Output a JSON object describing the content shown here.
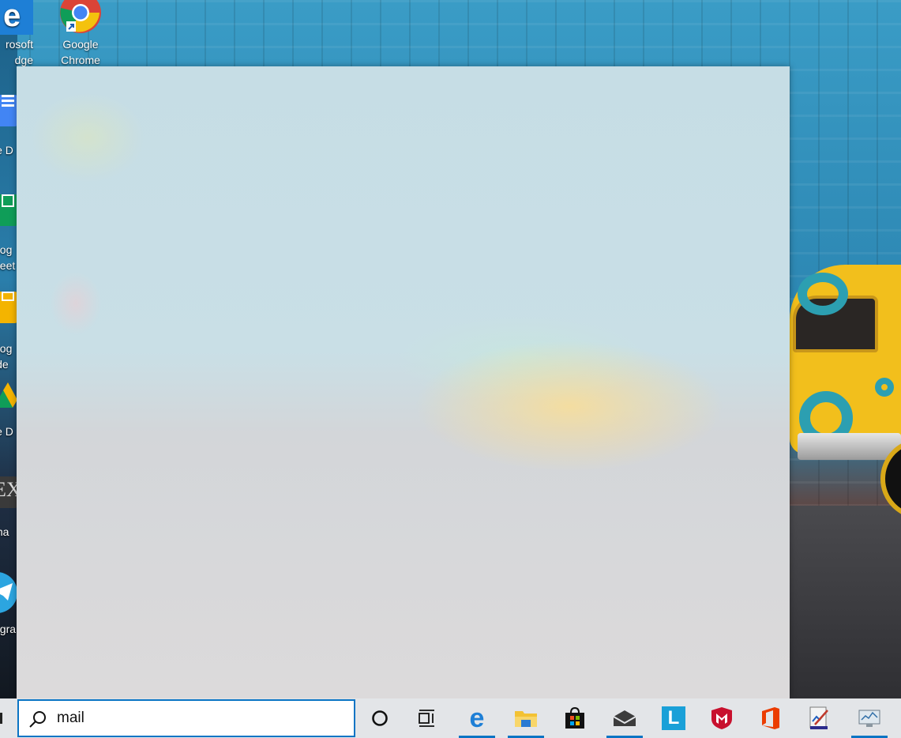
{
  "desktop": {
    "icons": [
      {
        "label": "rosoft\ndge",
        "icon": "microsoft-edge-icon"
      },
      {
        "label": "Google\nChrome",
        "icon": "google-chrome-icon"
      }
    ],
    "left_icons": [
      {
        "label": "le D",
        "icon": "google-docs-icon",
        "color": "#4285f4"
      },
      {
        "label": "oog\nheet",
        "icon": "google-sheets-icon",
        "color": "#0f9d58"
      },
      {
        "label": "oog\nide",
        "icon": "google-slides-icon",
        "color": "#f4b400"
      },
      {
        "label": "le D",
        "icon": "google-drive-icon",
        "color": "#f4b400"
      },
      {
        "label": "ma",
        "icon": "tex-maker-icon",
        "color": "#3a3a3a"
      },
      {
        "label": "egra",
        "icon": "telegram-icon",
        "color": "#2ca5e0"
      }
    ]
  },
  "start_panel": {},
  "taskbar": {
    "search": {
      "value": "mail",
      "icon": "search-icon"
    },
    "buttons": [
      {
        "name": "cortana",
        "icon": "cortana-circle-icon"
      },
      {
        "name": "task-view",
        "icon": "task-view-icon"
      },
      {
        "name": "edge",
        "icon": "microsoft-edge-icon",
        "active": true
      },
      {
        "name": "file-explorer",
        "icon": "folder-icon",
        "active": true
      },
      {
        "name": "store",
        "icon": "store-bag-icon"
      },
      {
        "name": "mail",
        "icon": "mail-envelope-icon",
        "active": true
      },
      {
        "name": "app-l",
        "icon": "l-app-icon"
      },
      {
        "name": "mcafee",
        "icon": "mcafee-shield-icon"
      },
      {
        "name": "office",
        "icon": "office-icon"
      },
      {
        "name": "paint-doc",
        "icon": "document-edit-icon"
      },
      {
        "name": "monitor",
        "icon": "monitor-chart-icon",
        "active": true
      }
    ]
  },
  "colors": {
    "accent": "#0a74c4",
    "taskbar_bg": "#e3e5e8"
  }
}
